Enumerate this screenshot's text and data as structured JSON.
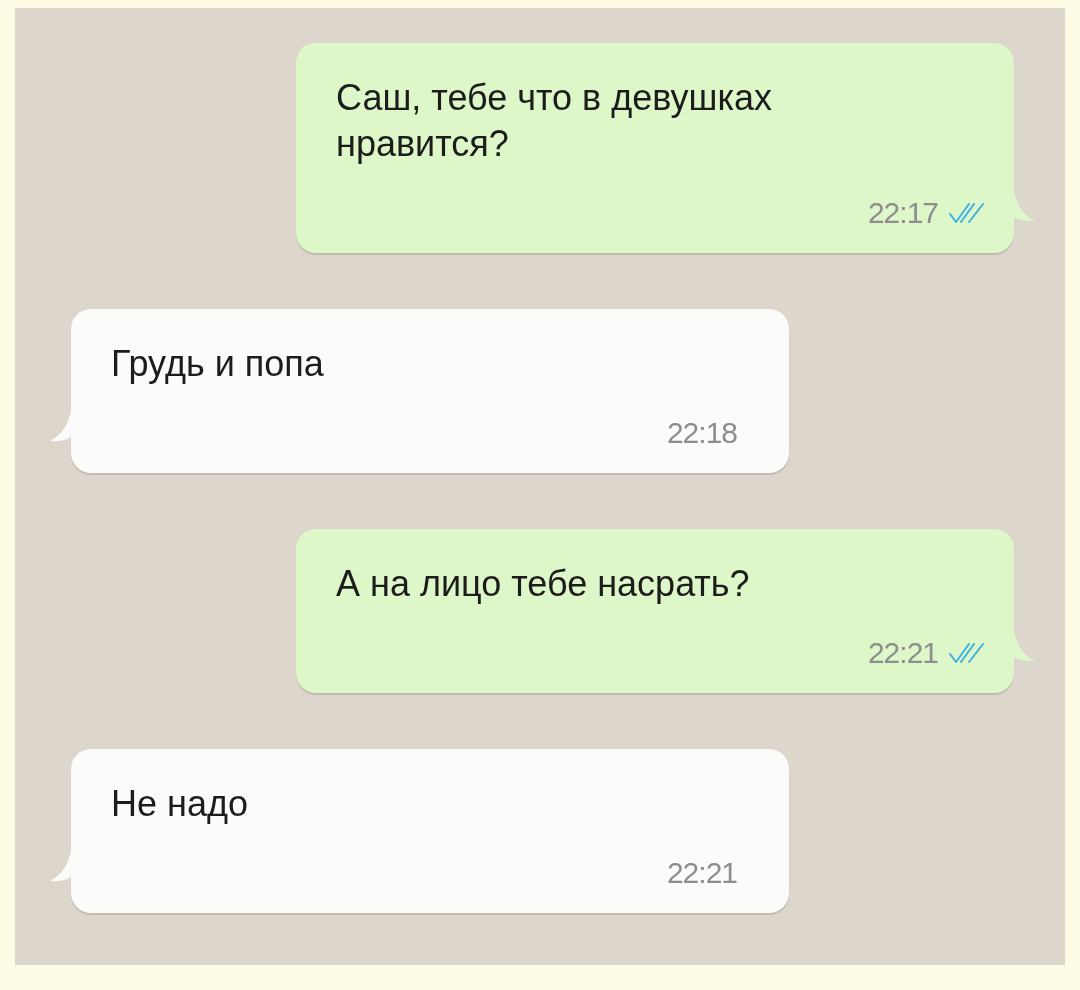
{
  "messages": [
    {
      "kind": "outgoing",
      "text": "Саш, тебе что в девушках нравится?",
      "time": "22:17",
      "read": true
    },
    {
      "kind": "incoming",
      "text": "Грудь и попа",
      "time": "22:18"
    },
    {
      "kind": "outgoing",
      "text": "А на лицо тебе насрать?",
      "time": "22:21",
      "read": true
    },
    {
      "kind": "incoming",
      "text": "Не надо",
      "time": "22:21"
    }
  ]
}
